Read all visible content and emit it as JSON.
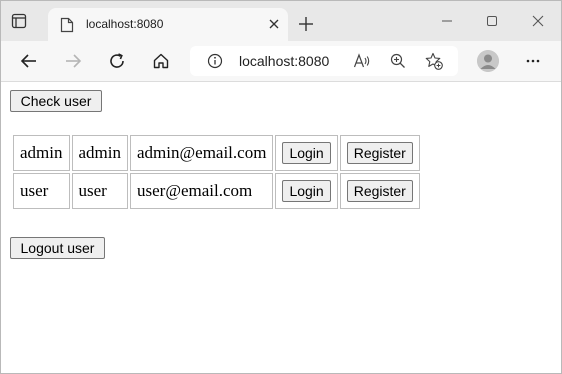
{
  "browser": {
    "tab": {
      "title": "localhost:8080"
    },
    "address": {
      "url": "localhost:8080"
    }
  },
  "page": {
    "check_button": "Check user",
    "logout_button": "Logout user",
    "rows": [
      {
        "name": "admin",
        "password": "admin",
        "email": "admin@email.com",
        "login": "Login",
        "register": "Register"
      },
      {
        "name": "user",
        "password": "user",
        "email": "user@email.com",
        "login": "Login",
        "register": "Register"
      }
    ]
  },
  "icons": {
    "tab_strip": "tab-actions-icon",
    "favicon": "page-icon",
    "tab_close": "close-icon",
    "new_tab": "plus-icon",
    "minimize": "minimize-icon",
    "maximize": "maximize-icon",
    "close": "close-icon",
    "back": "back-arrow-icon",
    "forward": "forward-arrow-icon",
    "reload": "reload-icon",
    "home": "home-icon",
    "info": "info-icon",
    "read_aloud": "read-aloud-icon",
    "zoom": "zoom-icon",
    "favorites": "add-favorite-icon",
    "profile": "profile-icon",
    "menu": "more-menu-icon"
  }
}
